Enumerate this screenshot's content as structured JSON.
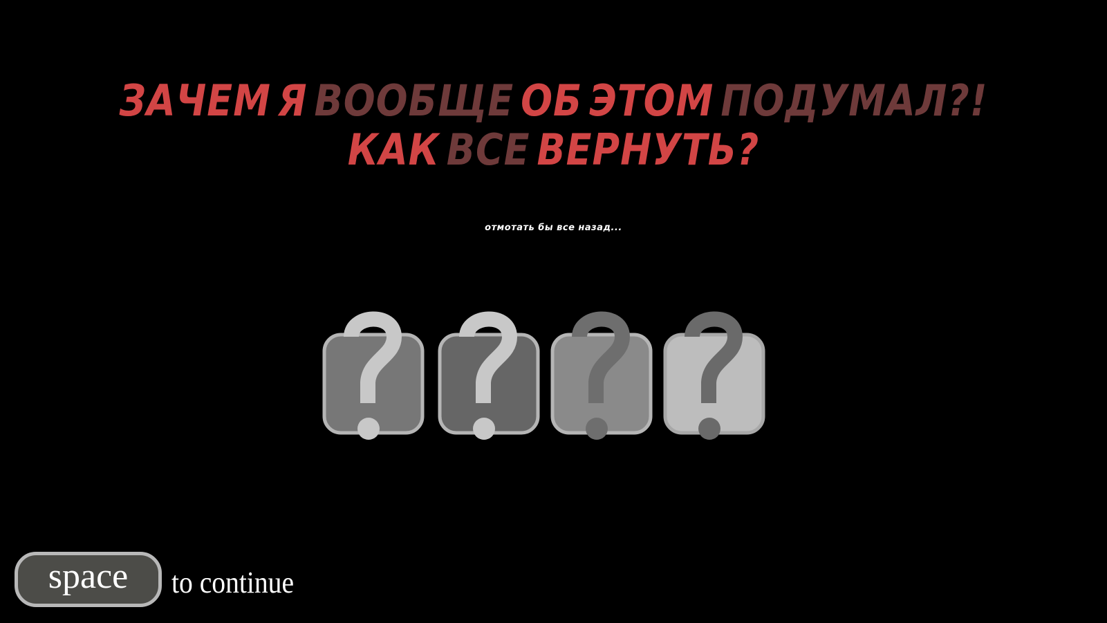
{
  "headline": {
    "line1": [
      {
        "text": "ЗАЧЕМ",
        "color": "#d24545"
      },
      {
        "text": "Я",
        "color": "#d24545"
      },
      {
        "text": "ВООБЩЕ",
        "color": "#6e3a3a"
      },
      {
        "text": "ОБ",
        "color": "#d24545"
      },
      {
        "text": "ЭТОМ",
        "color": "#d24545"
      },
      {
        "text": "ПОДУМАЛ?!",
        "color": "#6e3a3a"
      }
    ],
    "line2": [
      {
        "text": "КАК",
        "color": "#d24545"
      },
      {
        "text": "ВСЕ",
        "color": "#6e3a3a"
      },
      {
        "text": "ВЕРНУТЬ?",
        "color": "#d24545"
      }
    ]
  },
  "subtitle": "отмотать бы все назад...",
  "slots": [
    {
      "icon": "question-mark-icon",
      "box_color": "#777777",
      "border_color": "#b5b5b5",
      "mark_color": "#c8c8c8"
    },
    {
      "icon": "question-mark-icon",
      "box_color": "#666666",
      "border_color": "#b5b5b5",
      "mark_color": "#c8c8c8"
    },
    {
      "icon": "question-mark-icon",
      "box_color": "#8a8a8a",
      "border_color": "#b5b5b5",
      "mark_color": "#6e6e6e"
    },
    {
      "icon": "question-mark-icon",
      "box_color": "#bdbdbd",
      "border_color": "#a8a8a8",
      "mark_color": "#6a6a6a"
    }
  ],
  "prompt": {
    "key_label": "space",
    "action_label": "to continue"
  }
}
